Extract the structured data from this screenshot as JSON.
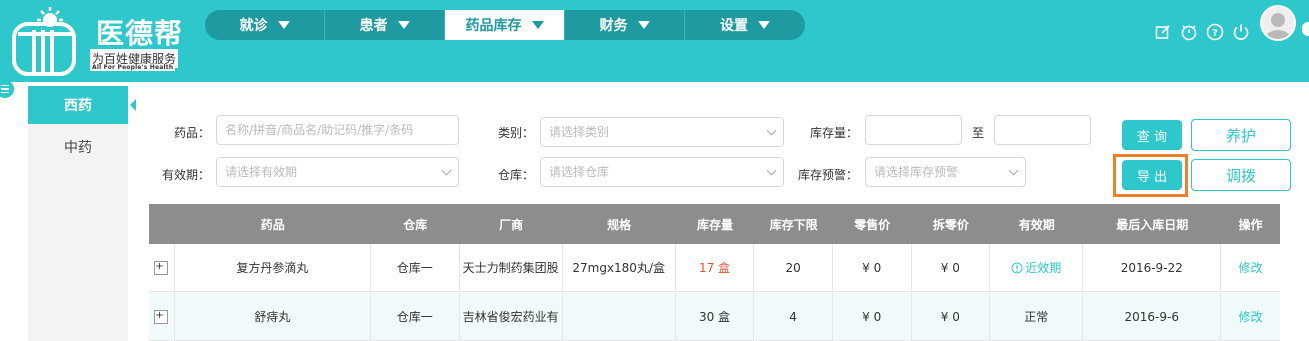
{
  "brand": {
    "name": "医德帮",
    "tagline_cn": "为百姓健康服务",
    "tagline_en": "All For People's Health"
  },
  "nav": {
    "items": [
      {
        "label": "就诊"
      },
      {
        "label": "患者"
      },
      {
        "label": "药品库存",
        "active": true
      },
      {
        "label": "财务"
      },
      {
        "label": "设置"
      }
    ]
  },
  "header_tools": [
    "edit-icon",
    "timer-icon",
    "help-icon",
    "power-icon"
  ],
  "sidebar": {
    "items": [
      {
        "label": "西药",
        "active": true
      },
      {
        "label": "中药"
      }
    ]
  },
  "filters": {
    "drug_label": "药品：",
    "drug_placeholder": "名称/拼音/商品名/助记码/推字/条码",
    "category_label": "类别：",
    "category_placeholder": "请选择类别",
    "stock_label": "库存量：",
    "stock_to": "至",
    "expiry_label": "有效期：",
    "expiry_placeholder": "请选择有效期",
    "warehouse_label": "仓库：",
    "warehouse_placeholder": "请选择仓库",
    "stock_warning_label": "库存预警：",
    "stock_warning_placeholder": "请选择库存预警"
  },
  "actions": {
    "query": "查 询",
    "maintain": "养护",
    "export": "导 出",
    "transfer": "调拨"
  },
  "table": {
    "columns": [
      "药品",
      "仓库",
      "厂商",
      "规格",
      "库存量",
      "库存下限",
      "零售价",
      "拆零价",
      "有效期",
      "最后入库日期",
      "操作"
    ],
    "rows": [
      {
        "drug": "复方丹参滴丸",
        "warehouse": "仓库一",
        "maker": "天士力制药集团股",
        "spec": "27mgx180丸/盒",
        "stock": "17 盒",
        "min_stock": "20",
        "retail": "¥ 0",
        "split": "¥ 0",
        "expiry": "近效期",
        "last_in": "2016-9-22",
        "op": "修改"
      },
      {
        "drug": "舒痔丸",
        "warehouse": "仓库一",
        "maker": "吉林省俊宏药业有",
        "spec": "",
        "stock": "30 盒",
        "min_stock": "4",
        "retail": "¥ 0",
        "split": "¥ 0",
        "expiry": "正常",
        "last_in": "2016-9-6",
        "op": "修改"
      }
    ]
  },
  "colors": {
    "accent": "#2ec7cc",
    "nav_bg": "#1f9aa0",
    "table_header": "#8d8d8d",
    "warning": "#e8532f",
    "highlight": "#f07f2a"
  }
}
